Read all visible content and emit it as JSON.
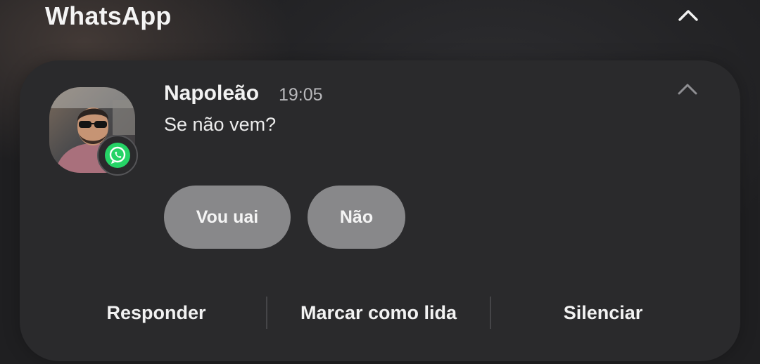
{
  "group": {
    "app_name": "WhatsApp",
    "collapse_icon": "chevron-up-icon"
  },
  "notification": {
    "sender": "Napoleão",
    "time": "19:05",
    "message": "Se não vem?",
    "avatar": "contact-avatar",
    "app_badge_icon": "whatsapp-icon",
    "collapse_icon": "chevron-up-icon",
    "smart_replies": [
      {
        "label": "Vou uai"
      },
      {
        "label": "Não"
      }
    ],
    "actions": [
      {
        "label": "Responder"
      },
      {
        "label": "Marcar como lida"
      },
      {
        "label": "Silenciar"
      }
    ]
  },
  "colors": {
    "background": "#1f1f21",
    "card": "#2a2a2c",
    "chip": "#88888a",
    "whatsapp_green": "#25d366",
    "secondary_text": "#b9b9bc"
  }
}
